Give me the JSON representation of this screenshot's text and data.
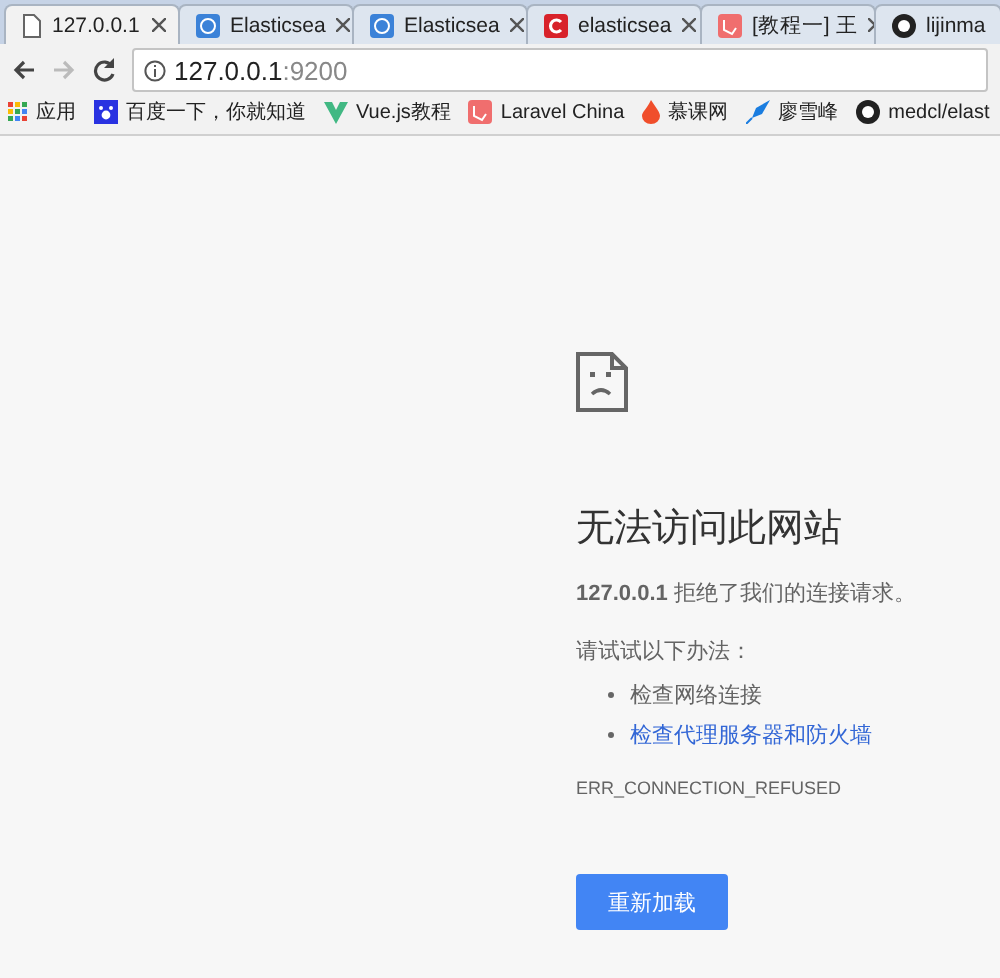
{
  "tabs": [
    {
      "title": "127.0.0.1",
      "kind": "page",
      "selected": true
    },
    {
      "title": "Elasticsea",
      "kind": "elastic",
      "selected": false
    },
    {
      "title": "Elasticsea",
      "kind": "elastic",
      "selected": false
    },
    {
      "title": "elasticsea",
      "kind": "red",
      "selected": false
    },
    {
      "title": "[教程一] 王",
      "kind": "laravel",
      "selected": false
    },
    {
      "title": "lijinma",
      "kind": "github",
      "selected": false
    }
  ],
  "address_bar": {
    "host": "127.0.0.1",
    "port": ":9200"
  },
  "bookmarks": [
    {
      "label": "应用",
      "kind": "apps"
    },
    {
      "label": "百度一下，你就知道",
      "kind": "paw"
    },
    {
      "label": "Vue.js教程",
      "kind": "vue"
    },
    {
      "label": "Laravel China",
      "kind": "laravel"
    },
    {
      "label": "慕课网",
      "kind": "flame"
    },
    {
      "label": "廖雪峰",
      "kind": "rocket"
    },
    {
      "label": "medcl/elast",
      "kind": "github"
    }
  ],
  "error": {
    "title": "无法访问此网站",
    "message": "**127.0.0.1** 拒绝了我们的连接请求。",
    "suggestions_heading": "请试试以下办法：",
    "suggestions": [
      {
        "text": "检查网络连接",
        "link": false
      },
      {
        "text": "检查代理服务器和防火墙",
        "link": true
      }
    ],
    "code": "ERR_CONNECTION_REFUSED",
    "button": "重新加载"
  }
}
